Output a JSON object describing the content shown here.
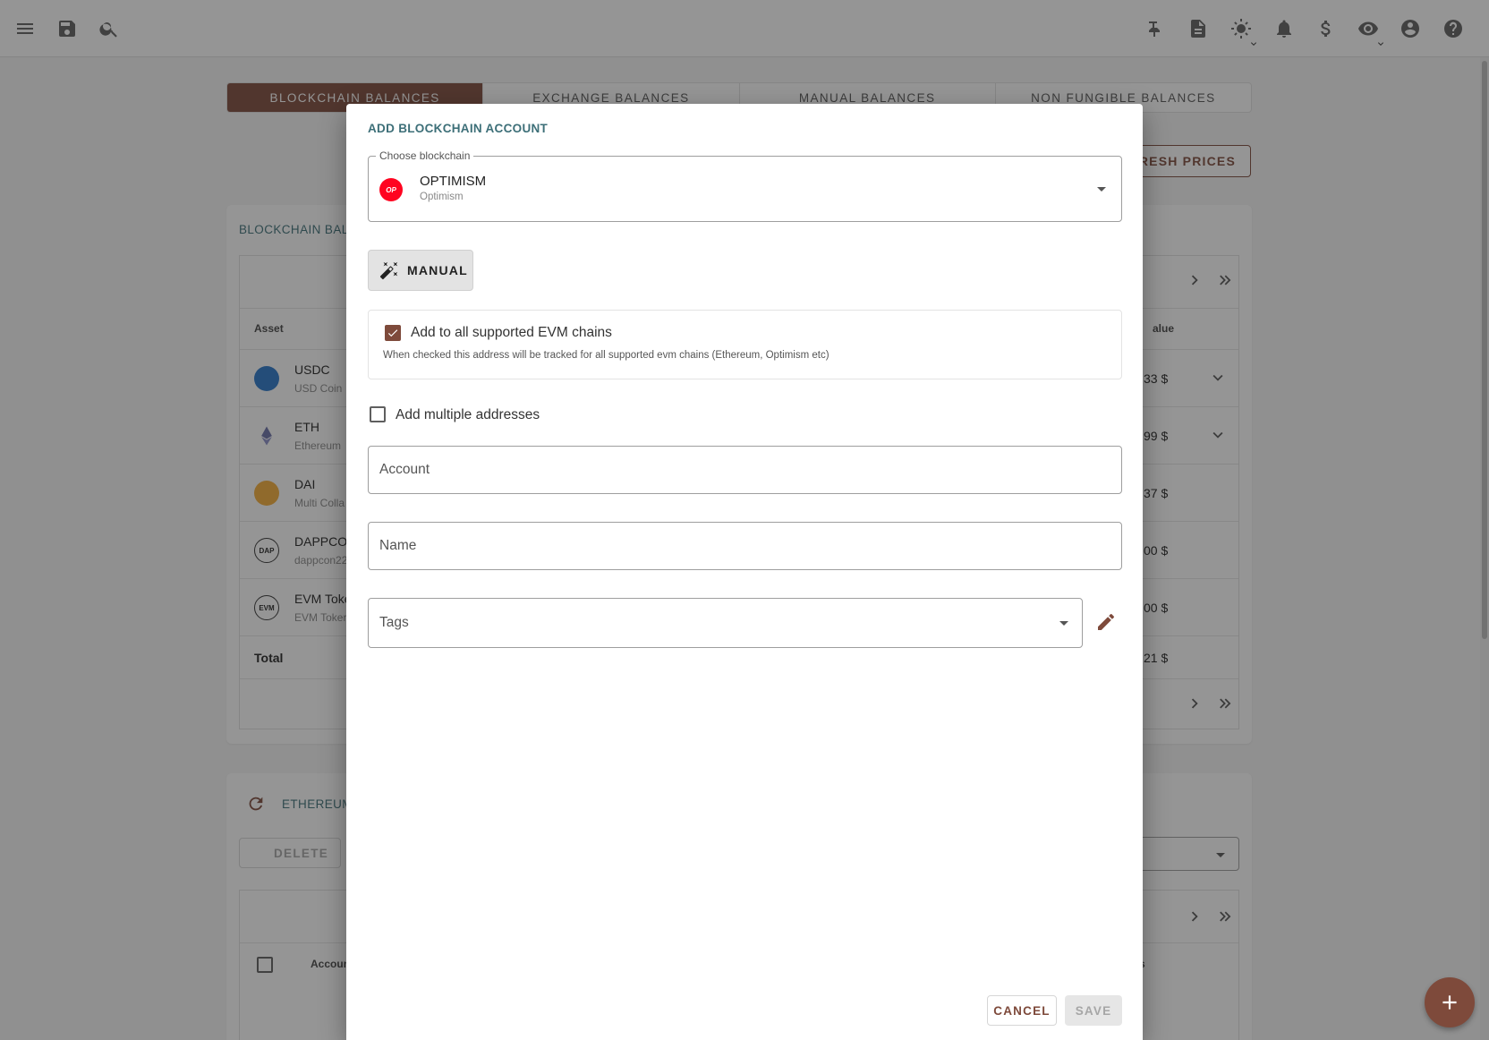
{
  "tabs": [
    {
      "label": "BLOCKCHAIN BALANCES",
      "active": true
    },
    {
      "label": "EXCHANGE BALANCES",
      "active": false
    },
    {
      "label": "MANUAL BALANCES",
      "active": false
    },
    {
      "label": "NON FUNGIBLE BALANCES",
      "active": false
    }
  ],
  "refresh_prices_label": "FRESH PRICES",
  "balances_card": {
    "title": "BLOCKCHAIN BALA",
    "header_asset": "Asset",
    "header_value": "alue",
    "rows": [
      {
        "name": "USDC",
        "sub": "USD Coin",
        "value": "33 $"
      },
      {
        "name": "ETH",
        "sub": "Ethereum",
        "value": "99 $"
      },
      {
        "name": "DAI",
        "sub": "Multi Colla",
        "value": "37 $"
      },
      {
        "name": "DAPPCO",
        "sub": "dappcon22",
        "value": "00 $"
      },
      {
        "name": "EVM Toke",
        "sub": "EVM Toker",
        "value": "00 $"
      }
    ],
    "total_label": "Total",
    "total_value": "21 $"
  },
  "eth_card": {
    "title": "ETHEREUM",
    "delete_label": "DELETE",
    "header_account": "Accoun",
    "header_right": "s"
  },
  "icons": {
    "DAP": "DAP",
    "EVM": "EVM",
    "OP": "OP"
  },
  "dialog": {
    "title": "ADD BLOCKCHAIN ACCOUNT",
    "blockchain_legend": "Choose blockchain",
    "chain_name": "OPTIMISM",
    "chain_sub": "Optimism",
    "manual_label": "MANUAL",
    "evm_label": "Add to all supported EVM chains",
    "evm_help": "When checked this address will be tracked for all supported evm chains (Ethereum, Optimism etc)",
    "multiple_label": "Add multiple addresses",
    "account_placeholder": "Account",
    "name_placeholder": "Name",
    "tags_placeholder": "Tags",
    "cancel_label": "CANCEL",
    "save_label": "SAVE"
  },
  "colors": {
    "accent": "#7e4a3b",
    "title": "#3d6f78",
    "optimism": "#ff0420"
  }
}
